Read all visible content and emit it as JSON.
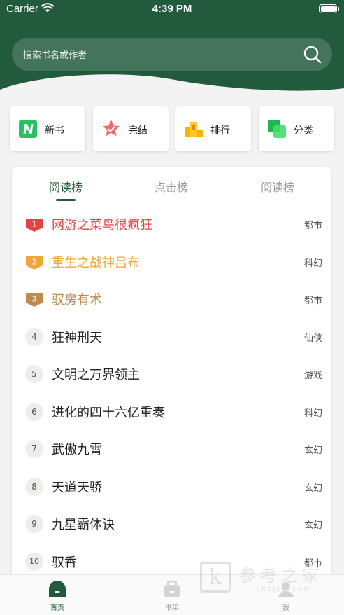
{
  "status_bar": {
    "carrier": "Carrier",
    "time": "4:39 PM"
  },
  "search": {
    "placeholder": "搜索书名或作者"
  },
  "categories": [
    {
      "label": "新书",
      "icon": "new-badge-icon"
    },
    {
      "label": "完结",
      "icon": "star-check-icon"
    },
    {
      "label": "排行",
      "icon": "podium-icon"
    },
    {
      "label": "分类",
      "icon": "squares-icon"
    }
  ],
  "ranking": {
    "tabs": [
      {
        "label": "阅读榜",
        "active": true
      },
      {
        "label": "点击榜",
        "active": false
      },
      {
        "label": "阅读榜",
        "active": false
      }
    ],
    "items": [
      {
        "rank": "1",
        "title": "网游之菜鸟很疯狂",
        "genre": "都市"
      },
      {
        "rank": "2",
        "title": "重生之战神吕布",
        "genre": "科幻"
      },
      {
        "rank": "3",
        "title": "驭房有术",
        "genre": "都市"
      },
      {
        "rank": "4",
        "title": "狂神刑天",
        "genre": "仙侠"
      },
      {
        "rank": "5",
        "title": "文明之万界领主",
        "genre": "游戏"
      },
      {
        "rank": "6",
        "title": "进化的四十六亿重奏",
        "genre": "科幻"
      },
      {
        "rank": "7",
        "title": "武傲九霄",
        "genre": "玄幻"
      },
      {
        "rank": "8",
        "title": "天道天骄",
        "genre": "玄幻"
      },
      {
        "rank": "9",
        "title": "九星霸体诀",
        "genre": "玄幻"
      },
      {
        "rank": "10",
        "title": "驭香",
        "genre": "都市"
      }
    ],
    "top_colors": [
      "#e04545",
      "#f0a73a",
      "#c0894e"
    ]
  },
  "tabbar": [
    {
      "label": "首页",
      "icon": "home-icon",
      "active": true
    },
    {
      "label": "书架",
      "icon": "bookshelf-icon",
      "active": false
    },
    {
      "label": "我",
      "icon": "profile-icon",
      "active": false
    }
  ],
  "watermark": {
    "title": "参考之家",
    "url": "ckzjzb.com"
  },
  "colors": {
    "primary": "#215a3c",
    "background": "#f3f3f3"
  }
}
